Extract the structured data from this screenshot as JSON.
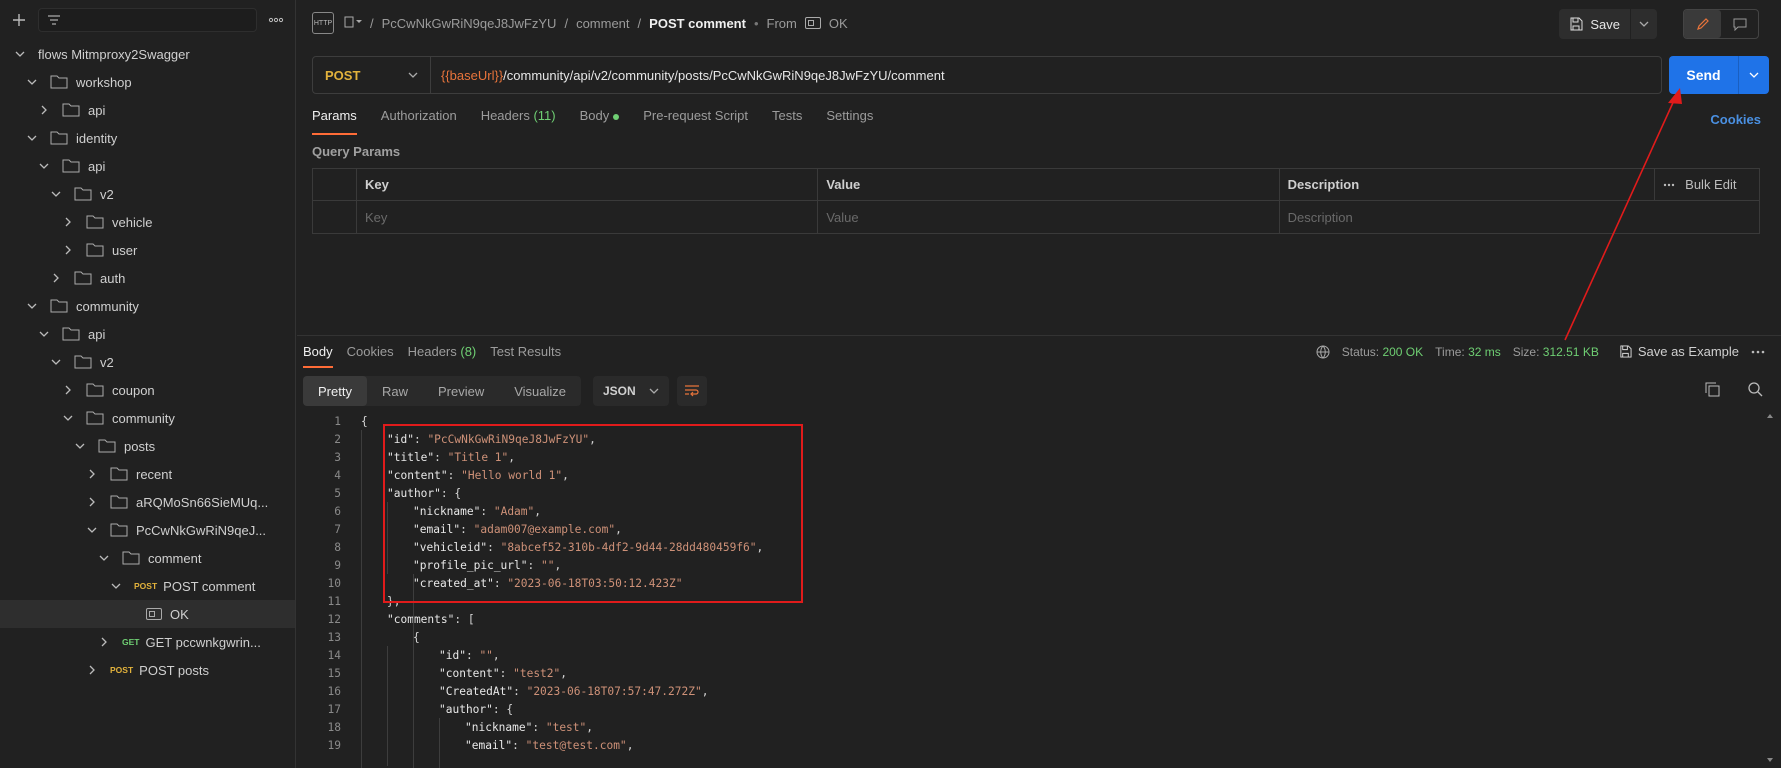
{
  "sidebar": {
    "filter_placeholder": "",
    "tree": [
      {
        "label": "flows Mitmproxy2Swagger",
        "kind": "collection",
        "depth": 0,
        "open": true
      },
      {
        "label": "workshop",
        "kind": "folder",
        "depth": 1,
        "open": true
      },
      {
        "label": "api",
        "kind": "folder",
        "depth": 2,
        "open": false
      },
      {
        "label": "identity",
        "kind": "folder",
        "depth": 1,
        "open": true
      },
      {
        "label": "api",
        "kind": "folder",
        "depth": 2,
        "open": true
      },
      {
        "label": "v2",
        "kind": "folder",
        "depth": 3,
        "open": true
      },
      {
        "label": "vehicle",
        "kind": "folder",
        "depth": 4,
        "open": false
      },
      {
        "label": "user",
        "kind": "folder",
        "depth": 4,
        "open": false
      },
      {
        "label": "auth",
        "kind": "folder",
        "depth": 3,
        "open": false
      },
      {
        "label": "community",
        "kind": "folder",
        "depth": 1,
        "open": true
      },
      {
        "label": "api",
        "kind": "folder",
        "depth": 2,
        "open": true
      },
      {
        "label": "v2",
        "kind": "folder",
        "depth": 3,
        "open": true
      },
      {
        "label": "coupon",
        "kind": "folder",
        "depth": 4,
        "open": false
      },
      {
        "label": "community",
        "kind": "folder",
        "depth": 4,
        "open": true
      },
      {
        "label": "posts",
        "kind": "folder",
        "depth": 5,
        "open": true
      },
      {
        "label": "recent",
        "kind": "folder",
        "depth": 6,
        "open": false
      },
      {
        "label": "aRQMoSn66SieMUq...",
        "kind": "folder",
        "depth": 6,
        "open": false
      },
      {
        "label": "PcCwNkGwRiN9qeJ...",
        "kind": "folder",
        "depth": 6,
        "open": true
      },
      {
        "label": "comment",
        "kind": "folder",
        "depth": 7,
        "open": true
      },
      {
        "label": "POST comment",
        "kind": "request",
        "method": "POST",
        "depth": 8,
        "open": true
      },
      {
        "label": "OK",
        "kind": "example",
        "depth": 9,
        "selected": true
      },
      {
        "label": "GET pccwnkgwrin...",
        "kind": "request",
        "method": "GET",
        "depth": 7,
        "open": false
      },
      {
        "label": "POST posts",
        "kind": "request",
        "method": "POST",
        "depth": 6,
        "open": false
      }
    ]
  },
  "header": {
    "crumb_1": "PcCwNkGwRiN9qeJ8JwFzYU",
    "crumb_2": "comment",
    "crumb_3": "POST comment",
    "from_label": "From",
    "from_example": "OK",
    "save_label": "Save"
  },
  "request": {
    "method": "POST",
    "url_var": "{{baseUrl}}",
    "url_path": "/community/api/v2/community/posts/PcCwNkGwRiN9qeJ8JwFzYU/comment",
    "send_label": "Send",
    "tabs": {
      "params": "Params",
      "authorization": "Authorization",
      "headers": "Headers",
      "headers_count": "(11)",
      "body": "Body",
      "prerequest": "Pre-request Script",
      "tests": "Tests",
      "settings": "Settings"
    },
    "cookies_label": "Cookies",
    "query_params_title": "Query Params",
    "table_headers": {
      "key": "Key",
      "value": "Value",
      "description": "Description",
      "bulk_edit": "Bulk Edit"
    },
    "placeholders": {
      "key": "Key",
      "value": "Value",
      "description": "Description"
    }
  },
  "response": {
    "tabs": {
      "body": "Body",
      "cookies": "Cookies",
      "headers": "Headers",
      "headers_count": "(8)",
      "test_results": "Test Results"
    },
    "status_label": "Status:",
    "status_value": "200 OK",
    "time_label": "Time:",
    "time_value": "32 ms",
    "size_label": "Size:",
    "size_value": "312.51 KB",
    "save_example": "Save as Example",
    "view_tabs": {
      "pretty": "Pretty",
      "raw": "Raw",
      "preview": "Preview",
      "visualize": "Visualize"
    },
    "format": "JSON",
    "lines": [
      {
        "n": "1",
        "indent": 0,
        "tokens": [
          [
            "p",
            "{"
          ]
        ]
      },
      {
        "n": "2",
        "indent": 1,
        "tokens": [
          [
            "k",
            "\"id\""
          ],
          [
            "p",
            ": "
          ],
          [
            "s",
            "\"PcCwNkGwRiN9qeJ8JwFzYU\""
          ],
          [
            "p",
            ","
          ]
        ]
      },
      {
        "n": "3",
        "indent": 1,
        "tokens": [
          [
            "k",
            "\"title\""
          ],
          [
            "p",
            ": "
          ],
          [
            "s",
            "\"Title 1\""
          ],
          [
            "p",
            ","
          ]
        ]
      },
      {
        "n": "4",
        "indent": 1,
        "tokens": [
          [
            "k",
            "\"content\""
          ],
          [
            "p",
            ": "
          ],
          [
            "s",
            "\"Hello world 1\""
          ],
          [
            "p",
            ","
          ]
        ]
      },
      {
        "n": "5",
        "indent": 1,
        "tokens": [
          [
            "k",
            "\"author\""
          ],
          [
            "p",
            ": {"
          ]
        ]
      },
      {
        "n": "6",
        "indent": 2,
        "tokens": [
          [
            "k",
            "\"nickname\""
          ],
          [
            "p",
            ": "
          ],
          [
            "s",
            "\"Adam\""
          ],
          [
            "p",
            ","
          ]
        ]
      },
      {
        "n": "7",
        "indent": 2,
        "tokens": [
          [
            "k",
            "\"email\""
          ],
          [
            "p",
            ": "
          ],
          [
            "s",
            "\"adam007@example.com\""
          ],
          [
            "p",
            ","
          ]
        ]
      },
      {
        "n": "8",
        "indent": 2,
        "tokens": [
          [
            "k",
            "\"vehicleid\""
          ],
          [
            "p",
            ": "
          ],
          [
            "s",
            "\"8abcef52-310b-4df2-9d44-28dd480459f6\""
          ],
          [
            "p",
            ","
          ]
        ]
      },
      {
        "n": "9",
        "indent": 2,
        "tokens": [
          [
            "k",
            "\"profile_pic_url\""
          ],
          [
            "p",
            ": "
          ],
          [
            "s",
            "\"\""
          ],
          [
            "p",
            ","
          ]
        ]
      },
      {
        "n": "10",
        "indent": 2,
        "tokens": [
          [
            "k",
            "\"created_at\""
          ],
          [
            "p",
            ": "
          ],
          [
            "s",
            "\"2023-06-18T03:50:12.423Z\""
          ]
        ]
      },
      {
        "n": "11",
        "indent": 1,
        "tokens": [
          [
            "p",
            "},"
          ]
        ]
      },
      {
        "n": "12",
        "indent": 1,
        "tokens": [
          [
            "k",
            "\"comments\""
          ],
          [
            "p",
            ": ["
          ]
        ]
      },
      {
        "n": "13",
        "indent": 2,
        "tokens": [
          [
            "p",
            "{"
          ]
        ]
      },
      {
        "n": "14",
        "indent": 3,
        "tokens": [
          [
            "k",
            "\"id\""
          ],
          [
            "p",
            ": "
          ],
          [
            "s",
            "\"\""
          ],
          [
            "p",
            ","
          ]
        ]
      },
      {
        "n": "15",
        "indent": 3,
        "tokens": [
          [
            "k",
            "\"content\""
          ],
          [
            "p",
            ": "
          ],
          [
            "s",
            "\"test2\""
          ],
          [
            "p",
            ","
          ]
        ]
      },
      {
        "n": "16",
        "indent": 3,
        "tokens": [
          [
            "k",
            "\"CreatedAt\""
          ],
          [
            "p",
            ": "
          ],
          [
            "s",
            "\"2023-06-18T07:57:47.272Z\""
          ],
          [
            "p",
            ","
          ]
        ]
      },
      {
        "n": "17",
        "indent": 3,
        "tokens": [
          [
            "k",
            "\"author\""
          ],
          [
            "p",
            ": {"
          ]
        ]
      },
      {
        "n": "18",
        "indent": 4,
        "tokens": [
          [
            "k",
            "\"nickname\""
          ],
          [
            "p",
            ": "
          ],
          [
            "s",
            "\"test\""
          ],
          [
            "p",
            ","
          ]
        ]
      },
      {
        "n": "19",
        "indent": 4,
        "tokens": [
          [
            "k",
            "\"email\""
          ],
          [
            "p",
            ": "
          ],
          [
            "s",
            "\"test@test.com\""
          ],
          [
            "p",
            ","
          ]
        ]
      }
    ]
  },
  "colors": {
    "accent": "#ff6c37",
    "send": "#1f73e8",
    "post": "#e2b23c",
    "get": "#6fcf73",
    "string": "#ce9178",
    "annotation": "#e01b1b"
  }
}
